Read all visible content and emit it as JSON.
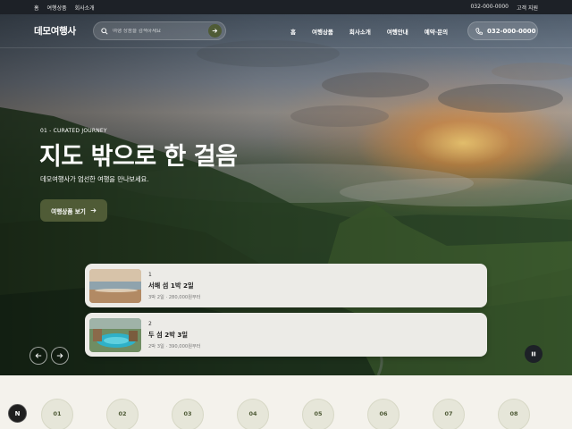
{
  "utility_bar": {
    "links": [
      "홈",
      "여행상품",
      "회사소개"
    ],
    "phone": "032-000-0000",
    "support": "고객 지원"
  },
  "header": {
    "logo": "데모여행사",
    "search_placeholder": "여행 상품을 검색하세요",
    "nav": [
      "홈",
      "여행상품",
      "회사소개",
      "여행안내",
      "예약·문의"
    ],
    "phone": "032-000-0000"
  },
  "hero": {
    "eyebrow": "01 - CURATED JOURNEY",
    "headline": "지도 밖으로 한 걸음",
    "subtitle": "데모여행사가 엄선한 여행을 만나보세요.",
    "cta_label": "여행상품 보기"
  },
  "tours": [
    {
      "num": "1",
      "title": "서해 섬 1박 2일",
      "meta": "3박 2일 · 280,000원부터"
    },
    {
      "num": "2",
      "title": "두 섬 2박 3일",
      "meta": "2박 3일 · 390,000원부터"
    }
  ],
  "steps": [
    "01",
    "02",
    "03",
    "04",
    "05",
    "06",
    "07",
    "08"
  ],
  "badge": "N",
  "colors": {
    "accent": "#4f5b36",
    "dark": "#1d2127",
    "bottom_bg": "#f4f2ec"
  }
}
